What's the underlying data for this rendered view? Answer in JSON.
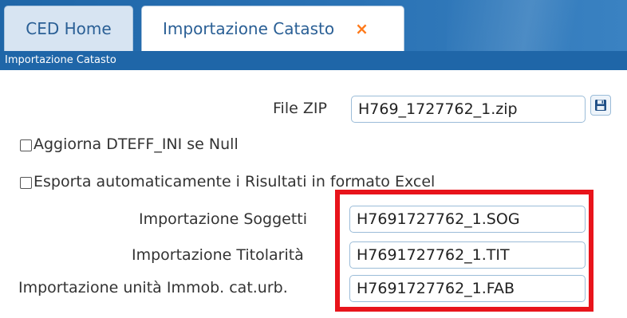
{
  "tabs": {
    "home_label": "CED Home",
    "active_label": "Importazione Catasto",
    "close_symbol": "×"
  },
  "window": {
    "title": "Importazione Catasto"
  },
  "form": {
    "file_zip_label": "File ZIP",
    "file_zip_value": "H769_1727762_1.zip",
    "checkbox_dteff_label": "Aggiorna DTEFF_INI se Null",
    "checkbox_dteff_checked": false,
    "checkbox_excel_label": "Esporta automaticamente i Risultati in formato Excel",
    "checkbox_excel_checked": false,
    "soggetti_label": "Importazione Soggetti",
    "soggetti_value": "H7691727762_1.SOG",
    "titolarita_label": "Importazione Titolarità",
    "titolarita_value": "H7691727762_1.TIT",
    "unita_label": "Importazione unità Immob. cat.urb.",
    "unita_value": "H7691727762_1.FAB"
  },
  "icons": {
    "save": "floppy-disk-icon"
  },
  "colors": {
    "header_blue": "#1f66a8",
    "tab_text": "#2a5f95",
    "close_orange": "#ff7a1a",
    "highlight_red": "#e8141b"
  }
}
